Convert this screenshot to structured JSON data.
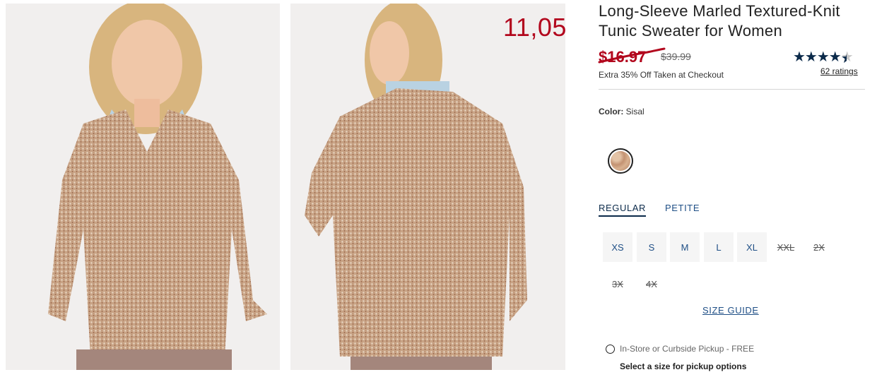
{
  "overlay_number": "11,05",
  "product": {
    "title": "Long-Sleeve Marled Textured-Knit Tunic Sweater for Women",
    "sale_price": "$16.97",
    "original_price": "$39.99",
    "promo": "Extra 35% Off Taken at Checkout",
    "rating_stars": "★★★★★",
    "rating_value": 4.5,
    "ratings_count": "62 ratings"
  },
  "color": {
    "label": "Color:",
    "value": "Sisal",
    "swatch_name": "color-swatch"
  },
  "fit_tabs": [
    {
      "label": "REGULAR",
      "selected": true
    },
    {
      "label": "PETITE",
      "selected": false
    }
  ],
  "sizes": [
    {
      "label": "XS",
      "available": true
    },
    {
      "label": "S",
      "available": true
    },
    {
      "label": "M",
      "available": true
    },
    {
      "label": "L",
      "available": true
    },
    {
      "label": "XL",
      "available": true
    },
    {
      "label": "XXL",
      "available": false
    },
    {
      "label": "2X",
      "available": false
    },
    {
      "label": "3X",
      "available": false
    },
    {
      "label": "4X",
      "available": false
    }
  ],
  "size_guide": "SIZE GUIDE",
  "pickup": {
    "label": "In-Store or Curbside Pickup - FREE",
    "note": "Select a size for pickup options"
  },
  "colors": {
    "sale_red": "#b2071d",
    "navy": "#0b2a4a",
    "link_blue": "#1f4f86"
  }
}
